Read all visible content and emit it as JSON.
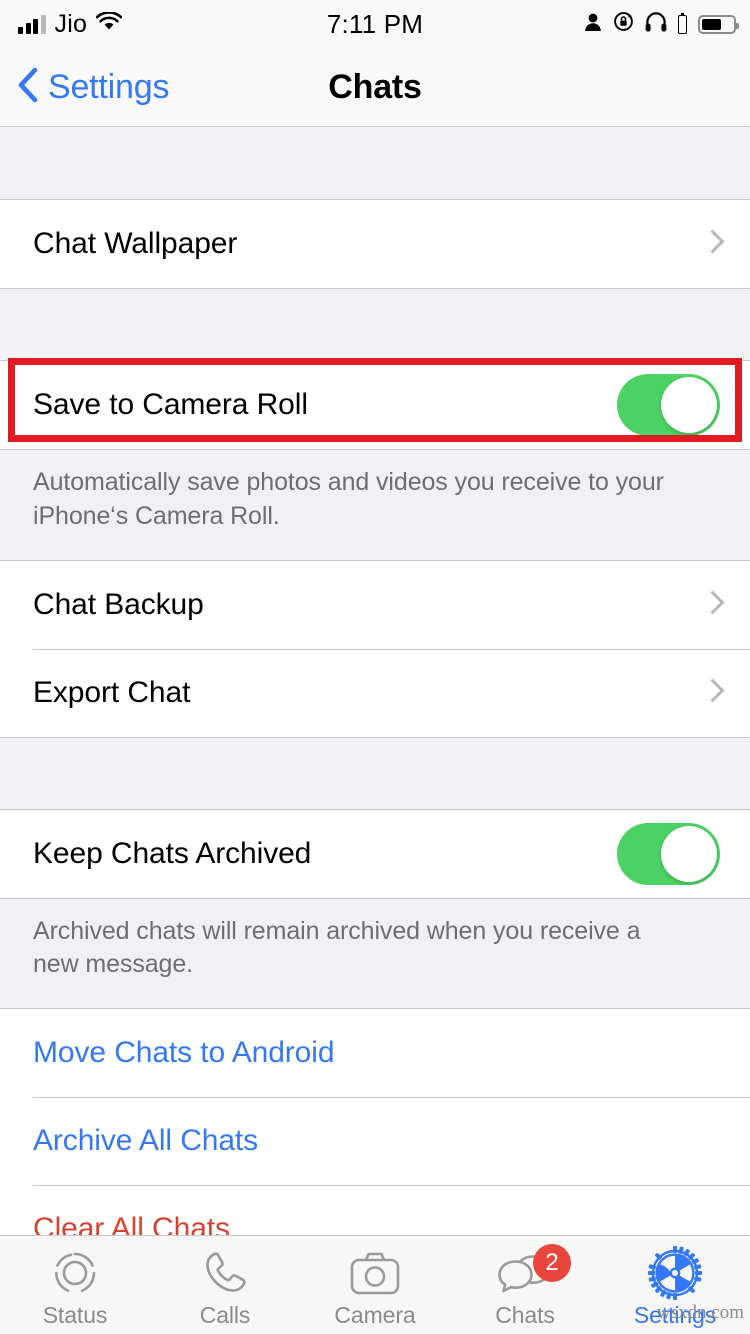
{
  "status_bar": {
    "carrier": "Jio",
    "time": "7:11 PM",
    "icons": [
      "signal-bars-icon",
      "wifi-icon",
      "person-icon",
      "rotation-lock-icon",
      "headphones-icon",
      "headphone-battery-icon",
      "battery-icon"
    ]
  },
  "nav": {
    "back_label": "Settings",
    "title": "Chats"
  },
  "sections": [
    {
      "rows": [
        {
          "label": "Chat Wallpaper",
          "type": "disclosure"
        }
      ]
    },
    {
      "rows": [
        {
          "label": "Save to Camera Roll",
          "type": "toggle",
          "value": "on"
        }
      ],
      "footnote": "Automatically save photos and videos you receive to your iPhone‘s Camera Roll."
    },
    {
      "rows": [
        {
          "label": "Chat Backup",
          "type": "disclosure"
        },
        {
          "label": "Export Chat",
          "type": "disclosure"
        }
      ]
    },
    {
      "rows": [
        {
          "label": "Keep Chats Archived",
          "type": "toggle",
          "value": "on"
        }
      ],
      "footnote": "Archived chats will remain archived when you receive a new message."
    },
    {
      "rows": [
        {
          "label": "Move Chats to Android",
          "type": "link"
        },
        {
          "label": "Archive All Chats",
          "type": "link"
        },
        {
          "label": "Clear All Chats",
          "type": "danger"
        }
      ]
    }
  ],
  "highlight": {
    "target": "Save to Camera Roll",
    "color": "#E01B22"
  },
  "tabbar": {
    "items": [
      {
        "label": "Status",
        "icon": "status-rings-icon",
        "active": false,
        "badge": ""
      },
      {
        "label": "Calls",
        "icon": "phone-icon",
        "active": false,
        "badge": ""
      },
      {
        "label": "Camera",
        "icon": "camera-icon",
        "active": false,
        "badge": ""
      },
      {
        "label": "Chats",
        "icon": "chat-bubbles-icon",
        "active": false,
        "badge": "2"
      },
      {
        "label": "Settings",
        "icon": "gear-icon",
        "active": true,
        "badge": ""
      }
    ]
  },
  "watermark": "wsxdn.com",
  "colors": {
    "accent_blue": "#3478F6",
    "toggle_green": "#4CD264",
    "danger_red": "#D7422F",
    "badge_red": "#E8453C",
    "highlight_red": "#E01B22",
    "group_bg": "#F1F1F5"
  }
}
